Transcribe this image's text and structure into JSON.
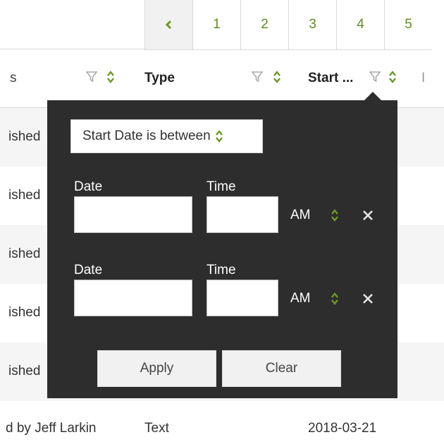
{
  "colors": {
    "accent": "#5d8d23",
    "popup_bg": "#2d2d2d"
  },
  "pagination": {
    "prev_icon": "chevron-left-icon",
    "pages": [
      "1",
      "2",
      "3",
      "4",
      "5"
    ]
  },
  "table": {
    "headers": {
      "status_partial": "s",
      "type": "Type",
      "start": "Start ...",
      "next_partial": "I"
    },
    "rows": [
      {
        "status": "ished"
      },
      {
        "status": "ished"
      },
      {
        "status": "ished"
      },
      {
        "status": "ished"
      },
      {
        "status": "ished"
      },
      {
        "name_partial": "d by Jeff Larkin",
        "type": "Text",
        "start": "2018-03-21"
      }
    ]
  },
  "filter_popup": {
    "condition": "Start Date is between",
    "range_from": {
      "date_label": "Date",
      "date_value": "",
      "time_label": "Time",
      "time_value": "",
      "ampm": "AM"
    },
    "range_to": {
      "date_label": "Date",
      "date_value": "",
      "time_label": "Time",
      "time_value": "",
      "ampm": "AM"
    },
    "apply_label": "Apply",
    "clear_label": "Clear"
  }
}
